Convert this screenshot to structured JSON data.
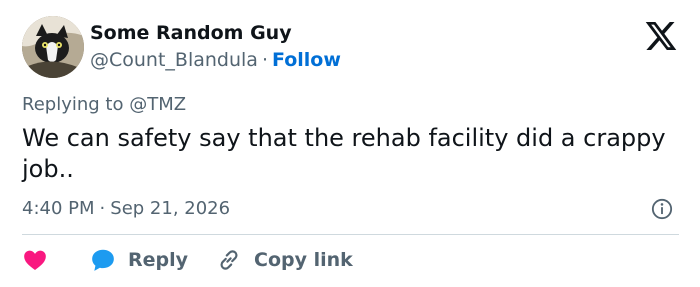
{
  "author": {
    "name": "Some Random Guy",
    "handle": "@Count_Blandula",
    "separator": "·",
    "follow_label": "Follow"
  },
  "reply_context": {
    "prefix": "Replying to",
    "mention": "@TMZ"
  },
  "tweet": {
    "text": "We can safety say that the rehab facility did a crappy job.."
  },
  "meta": {
    "time": "4:40 PM",
    "separator": "·",
    "date": "Sep 21, 2026"
  },
  "actions": {
    "reply_label": "Reply",
    "copy_link_label": "Copy link"
  },
  "icons": {
    "logo": "x-logo-icon",
    "info": "info-icon",
    "like": "heart-icon",
    "reply": "speech-bubble-icon",
    "copy_link": "link-icon"
  },
  "colors": {
    "like": "#f91880",
    "reply": "#1d9bf0",
    "follow": "#006fd6",
    "secondary_text": "#536471"
  }
}
